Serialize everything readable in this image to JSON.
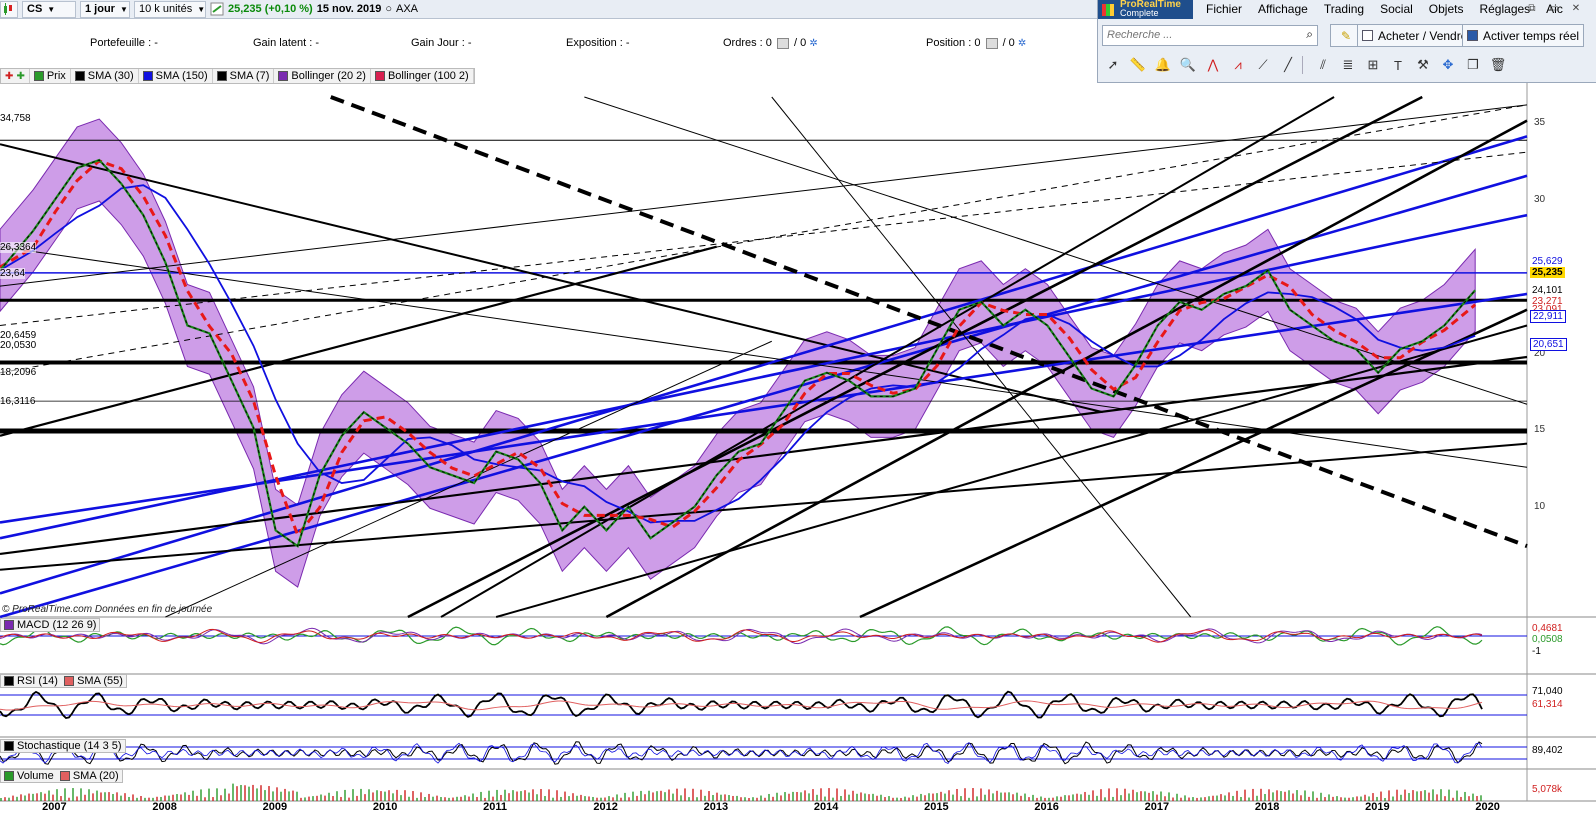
{
  "toolbar": {
    "symbol": "CS",
    "period": "1 jour",
    "units": "10 k unités",
    "price_change": "25,235 (+0,10 %)",
    "date": "15 nov. 2019",
    "instrument": "AXA"
  },
  "summary": {
    "portefeuille": "Portefeuille : -",
    "gain_latent": "Gain latent : -",
    "gain_jour": "Gain Jour : -",
    "exposition": "Exposition : -",
    "ordres_label": "Ordres :",
    "ordres_a": "0",
    "ordres_b": "/ 0",
    "position_label": "Position :",
    "position_a": "0",
    "position_b": "/ 0"
  },
  "app": {
    "logo_line1": "ProRealTime",
    "logo_line2": "Complete",
    "menu": [
      "Fichier",
      "Affichage",
      "Trading",
      "Social",
      "Objets",
      "Réglages",
      "Aic"
    ],
    "search_placeholder": "Recherche ...",
    "buy_sell": "Acheter / Vendre",
    "realtime": "Activer temps réel"
  },
  "legend": [
    "Prix",
    "SMA (30)",
    "SMA (150)",
    "SMA (7)",
    "Bollinger (20 2)",
    "Bollinger (100 2)"
  ],
  "panes": {
    "macd": "MACD (12 26 9)",
    "rsi": "RSI (14)",
    "rsi_sma": "SMA (55)",
    "stoch": "Stochastique (14 3 5)",
    "volume": "Volume",
    "volume_sma": "SMA (20)"
  },
  "watermark": "© ProRealTime.com  Données en fin de journée",
  "left_levels": [
    "34,758",
    "26,3364",
    "23,64",
    "20,6459",
    "20,0530",
    "18,2096",
    "16,3116"
  ],
  "right_badges": {
    "b1": "25,629",
    "price": "25,235",
    "b3": "24,101",
    "b4": "23,271",
    "b5": "23,091",
    "b6": "22,911",
    "b7": "20,651",
    "macd1": "0,4681",
    "macd2": "0,0508",
    "macd3": "-1",
    "rsi1": "71,040",
    "rsi2": "61,314",
    "stoch1": "89,402",
    "vol": "5,078k"
  },
  "colors": {
    "sma150": "#1010e0",
    "sma30": "#000000",
    "sma7": "#e81818",
    "bollinger_fill": "#a64dd6",
    "price_badge": "#ffd800"
  },
  "chart_data": {
    "type": "line",
    "title": "",
    "instrument": "AXA",
    "x_axis_years": [
      "2007",
      "2008",
      "2009",
      "2010",
      "2011",
      "2012",
      "2013",
      "2014",
      "2015",
      "2016",
      "2017",
      "2018",
      "2019",
      "2020"
    ],
    "y_ticks": [
      "35",
      "30",
      "25",
      "20",
      "15",
      "10"
    ],
    "ylim": [
      4.5,
      37.5
    ],
    "series": [
      {
        "name": "Prix",
        "x": [
          2006.5,
          2006.8,
          2007.0,
          2007.2,
          2007.4,
          2007.6,
          2007.8,
          2008.0,
          2008.2,
          2008.4,
          2008.6,
          2008.8,
          2009.0,
          2009.2,
          2009.4,
          2009.6,
          2009.8,
          2010.0,
          2010.2,
          2010.4,
          2010.6,
          2010.8,
          2011.0,
          2011.2,
          2011.4,
          2011.6,
          2011.8,
          2012.0,
          2012.2,
          2012.4,
          2012.6,
          2012.8,
          2013.0,
          2013.2,
          2013.4,
          2013.6,
          2013.8,
          2014.0,
          2014.2,
          2014.4,
          2014.6,
          2014.8,
          2015.0,
          2015.2,
          2015.4,
          2015.6,
          2015.8,
          2016.0,
          2016.2,
          2016.4,
          2016.6,
          2016.8,
          2017.0,
          2017.2,
          2017.4,
          2017.6,
          2017.8,
          2018.0,
          2018.2,
          2018.4,
          2018.6,
          2018.8,
          2019.0,
          2019.2,
          2019.4,
          2019.6,
          2019.88
        ],
        "y": [
          26.5,
          29.0,
          31.0,
          33.0,
          33.5,
          32.0,
          30.0,
          27.0,
          23.0,
          22.5,
          19.5,
          16.5,
          10.0,
          9.0,
          13.5,
          16.0,
          17.5,
          16.5,
          15.5,
          14.0,
          13.5,
          13.0,
          15.0,
          14.5,
          13.0,
          10.0,
          11.5,
          10.0,
          11.5,
          9.5,
          10.5,
          11.5,
          13.5,
          15.0,
          15.5,
          17.5,
          19.5,
          20.0,
          19.5,
          18.5,
          18.5,
          19.0,
          21.5,
          24.0,
          24.5,
          23.0,
          24.0,
          23.0,
          21.0,
          19.0,
          18.5,
          20.5,
          23.0,
          24.5,
          24.0,
          25.0,
          25.5,
          26.5,
          24.0,
          23.0,
          22.0,
          21.5,
          20.0,
          21.5,
          22.0,
          23.0,
          25.235
        ]
      }
    ],
    "last_close": "25,235",
    "date": "15 nov. 2019"
  }
}
